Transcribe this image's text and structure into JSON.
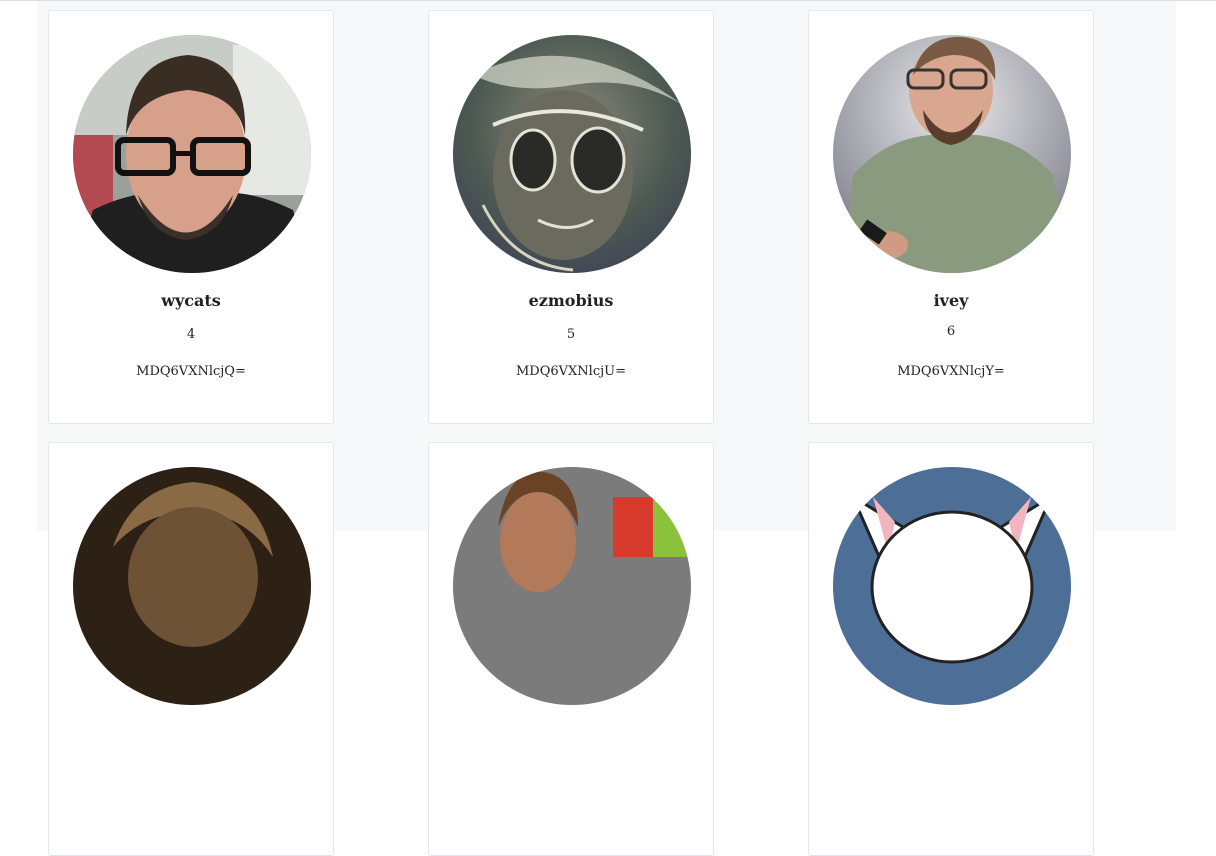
{
  "users": [
    {
      "login": "wycats",
      "id": "4",
      "node_id": "MDQ6VXNlcjQ="
    },
    {
      "login": "ezmobius",
      "id": "5",
      "node_id": "MDQ6VXNlcjU="
    },
    {
      "login": "ivey",
      "id": "6",
      "node_id": "MDQ6VXNlcjY="
    },
    {
      "login": "",
      "id": "",
      "node_id": ""
    },
    {
      "login": "",
      "id": "",
      "node_id": ""
    },
    {
      "login": "",
      "id": "",
      "node_id": ""
    }
  ]
}
